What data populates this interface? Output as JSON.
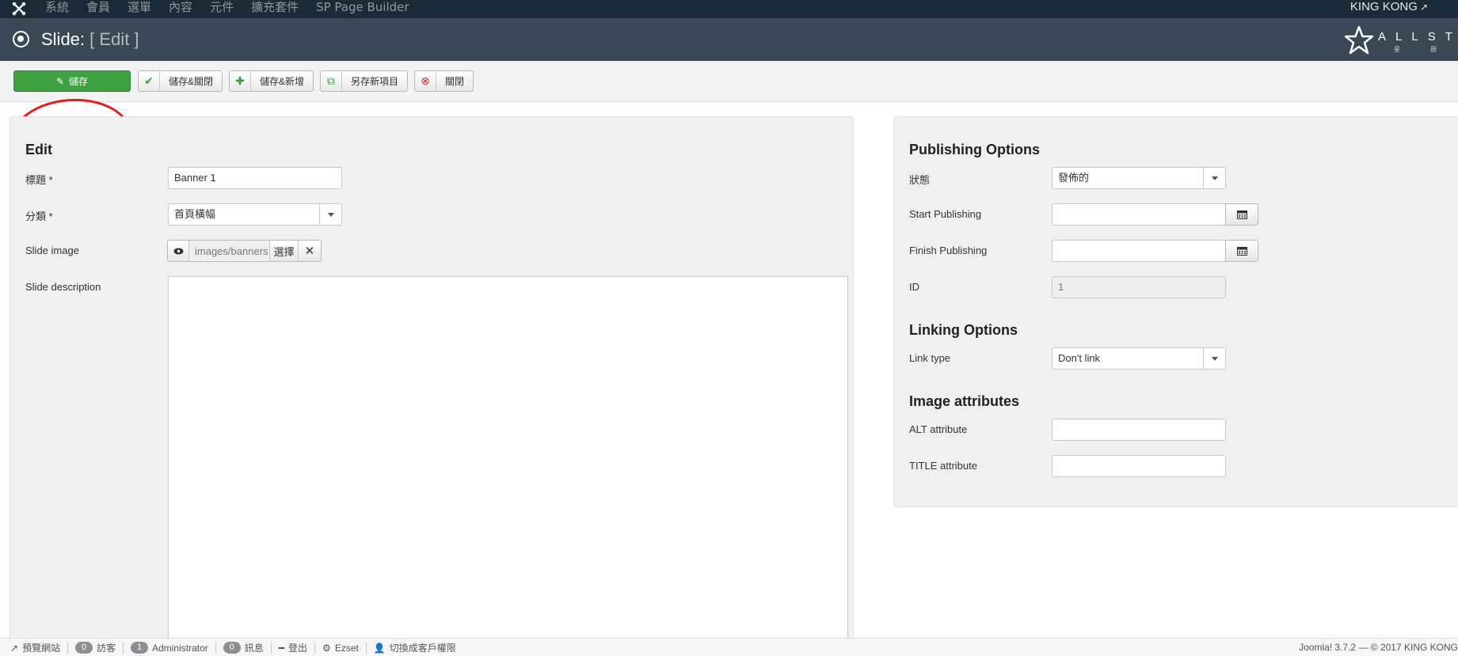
{
  "navbar": {
    "menu": [
      "系統",
      "會員",
      "選單",
      "內容",
      "元件",
      "擴充套件",
      "SP Page Builder"
    ],
    "user_label": "KING KONG"
  },
  "header": {
    "title": "Slide:",
    "subtitle": "[ Edit ]",
    "brand_word": "ALLSTA",
    "brand_tagline": "星 辰 設 計"
  },
  "toolbar": {
    "save": "儲存",
    "save_close": "儲存&關閉",
    "save_new": "儲存&新增",
    "save_copy": "另存新項目",
    "close": "關閉"
  },
  "edit": {
    "heading": "Edit",
    "title_label": "標題 *",
    "title_value": "Banner 1",
    "category_label": "分類 *",
    "category_value": "首頁橫幅",
    "image_label": "Slide image",
    "image_path": "images/banners",
    "image_select": "選擇",
    "description_label": "Slide description"
  },
  "publishing": {
    "heading": "Publishing Options",
    "status_label": "狀態",
    "status_value": "發佈的",
    "start_label": "Start Publishing",
    "start_value": "",
    "finish_label": "Finish Publishing",
    "finish_value": "",
    "id_label": "ID",
    "id_value": "1"
  },
  "linking": {
    "heading": "Linking Options",
    "type_label": "Link type",
    "type_value": "Don't link"
  },
  "image_attrs": {
    "heading": "Image attributes",
    "alt_label": "ALT attribute",
    "alt_value": "",
    "title_label": "TITLE attribute",
    "title_value": ""
  },
  "statusbar": {
    "preview": "預覽網站",
    "visitors_count": "0",
    "visitors_label": "訪客",
    "admin_count": "1",
    "admin_label": "Administrator",
    "messages_count": "0",
    "messages_label": "訊息",
    "logout": "登出",
    "ezset": "Ezset",
    "switch_user": "切換成客戶權限",
    "version": "Joomla! 3.7.2  —  © 2017 KING KONG"
  },
  "colors": {
    "navbar": "#1a2a36",
    "header": "#3a4855",
    "save_button": "#3fa142",
    "annotation": "#e02020"
  }
}
